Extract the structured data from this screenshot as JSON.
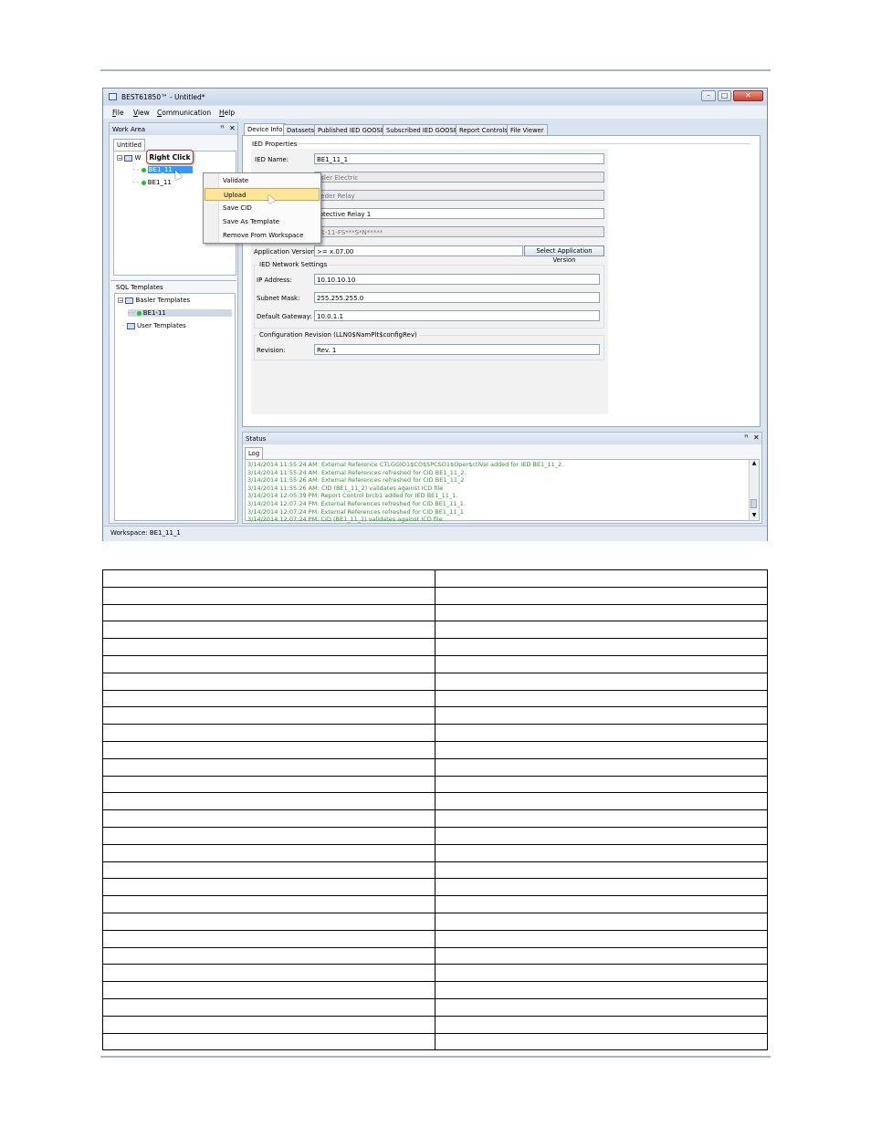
{
  "window": {
    "title": "BEST61850™ - Untitled*",
    "buttons": [
      "–",
      "□",
      "✕"
    ]
  },
  "menubar": {
    "items": [
      {
        "key": "F",
        "rest": "ile"
      },
      {
        "key": "V",
        "rest": "iew"
      },
      {
        "key": "C",
        "rest": "ommunication"
      },
      {
        "key": "H",
        "rest": "elp"
      }
    ]
  },
  "work_area": {
    "title": "Work Area",
    "tab": "Untitled",
    "root_label": "W",
    "items": [
      "BE1_11",
      "BE1_11"
    ],
    "callout": "Right Click"
  },
  "context_menu": {
    "items": [
      "Validate",
      "Upload",
      "Save CID",
      "Save As Template",
      "Remove From Workspace"
    ],
    "highlighted": "Upload"
  },
  "sql_templates": {
    "title": "SQL Templates",
    "groups": [
      {
        "label": "Basler Templates",
        "children": [
          "BE1-11"
        ]
      },
      {
        "label": "User Templates",
        "children": []
      }
    ]
  },
  "tabs": [
    "Device Info",
    "Datasets",
    "Published IED GOOSE",
    "Subscribed IED GOOSE",
    "Report Controls",
    "File Viewer"
  ],
  "ied_properties": {
    "section": "IED Properties",
    "ied_name_label": "IED Name:",
    "ied_name": "BE1_11_1",
    "manufacturer": "asler Electric",
    "type": "eeder Relay",
    "description": "rotective Relay 1",
    "style": "11-11-FS***S*N*****",
    "app_version_label": "Application Version:",
    "app_version": ">= x.07.00",
    "select_version_button": "Select Application Version"
  },
  "network": {
    "section": "IED Network Settings",
    "ip_label": "IP Address:",
    "ip": "10.10.10.10",
    "subnet_label": "Subnet Mask:",
    "subnet": "255.255.255.0",
    "gateway_label": "Default Gateway:",
    "gateway": "10.0.1.1"
  },
  "config_revision": {
    "section": "Configuration Revision (LLN0$NamPlt$configRev)",
    "revision_label": "Revision:",
    "revision": "Rev. 1"
  },
  "status": {
    "title": "Status",
    "tab": "Log",
    "lines": [
      "3/14/2014 11:55:24 AM: External Reference CTLGGIO1$CO$SPCSO1$Oper$ctlVal added for IED BE1_11_2.",
      "3/14/2014 11:55:24 AM: External References refreshed for CID BE1_11_2.",
      "3/14/2014 11:55:26 AM: External References refreshed for CID BE1_11_2",
      "3/14/2014 11:55:26 AM: CID (BE1_11_2) validates against ICD file",
      "3/14/2014 12:05:39 PM: Report Control brcb1 added for IED BE1_11_1.",
      "3/14/2014 12:07:24 PM: External References refreshed for CID BE1_11_1.",
      "3/14/2014 12:07:24 PM: External References refreshed for CID BE1_11_1",
      "3/14/2014 12:07:24 PM: CID (BE1_11_1) validates against ICD file"
    ]
  },
  "statusbar": {
    "workspace": "Workspace: BE1_11_1"
  },
  "table": {
    "rows": 28,
    "columns": 2
  }
}
